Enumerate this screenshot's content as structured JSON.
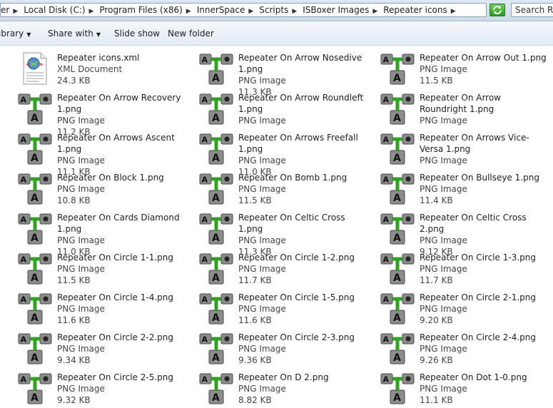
{
  "address": {
    "crumbs": [
      "er",
      "Local Disk (C:)",
      "Program Files (x86)",
      "InnerSpace",
      "Scripts",
      "ISBoxer Images",
      "Repeater icons"
    ],
    "search_placeholder": "Search Rep"
  },
  "toolbar": {
    "library": "ibrary",
    "share": "Share with",
    "slideshow": "Slide show",
    "newfolder": "New folder"
  },
  "files": [
    {
      "name": "Repeater icons.xml",
      "type": "XML Document",
      "size": "24.3 KB",
      "icon": "xml-document-icon"
    },
    {
      "name": "Repeater On Arrow Nosedive 1.png",
      "type": "PNG Image",
      "size": "11.3 KB",
      "icon": "repeater-png-icon"
    },
    {
      "name": "Repeater On Arrow Out 1.png",
      "type": "PNG Image",
      "size": "11.5 KB",
      "icon": "repeater-png-icon"
    },
    {
      "name": "Repeater On Arrow Recovery 1.png",
      "type": "PNG Image",
      "size": "11.2 KB",
      "icon": "repeater-png-icon"
    },
    {
      "name": "Repeater On Arrow Roundleft 1.png",
      "type": "PNG Image",
      "size": "",
      "icon": "repeater-png-icon"
    },
    {
      "name": "Repeater On Arrow Roundright 1.png",
      "type": "PNG Image",
      "size": "",
      "icon": "repeater-png-icon"
    },
    {
      "name": "Repeater On Arrows Ascent 1.png",
      "type": "PNG Image",
      "size": "11.1 KB",
      "icon": "repeater-png-icon"
    },
    {
      "name": "Repeater On Arrows Freefall 1.png",
      "type": "PNG Image",
      "size": "11.0 KB",
      "icon": "repeater-png-icon"
    },
    {
      "name": "Repeater On Arrows Vice-Versa 1.png",
      "type": "PNG Image",
      "size": "",
      "icon": "repeater-png-icon"
    },
    {
      "name": "Repeater On Block 1.png",
      "type": "PNG Image",
      "size": "10.8 KB",
      "icon": "repeater-png-icon"
    },
    {
      "name": "Repeater On Bomb 1.png",
      "type": "PNG Image",
      "size": "11.5 KB",
      "icon": "repeater-png-icon"
    },
    {
      "name": "Repeater On Bullseye 1.png",
      "type": "PNG Image",
      "size": "11.4 KB",
      "icon": "repeater-png-icon"
    },
    {
      "name": "Repeater On Cards Diamond 1.png",
      "type": "PNG Image",
      "size": "11.0 KB",
      "icon": "repeater-png-icon"
    },
    {
      "name": "Repeater On Celtic Cross 1.png",
      "type": "PNG Image",
      "size": "11.3 KB",
      "icon": "repeater-png-icon"
    },
    {
      "name": "Repeater On Celtic Cross 2.png",
      "type": "PNG Image",
      "size": "9.12 KB",
      "icon": "repeater-png-icon"
    },
    {
      "name": "Repeater On Circle 1-1.png",
      "type": "PNG Image",
      "size": "11.5 KB",
      "icon": "repeater-png-icon"
    },
    {
      "name": "Repeater On Circle 1-2.png",
      "type": "PNG Image",
      "size": "11.7 KB",
      "icon": "repeater-png-icon"
    },
    {
      "name": "Repeater On Circle 1-3.png",
      "type": "PNG Image",
      "size": "11.7 KB",
      "icon": "repeater-png-icon"
    },
    {
      "name": "Repeater On Circle 1-4.png",
      "type": "PNG Image",
      "size": "11.6 KB",
      "icon": "repeater-png-icon"
    },
    {
      "name": "Repeater On Circle 1-5.png",
      "type": "PNG Image",
      "size": "11.6 KB",
      "icon": "repeater-png-icon"
    },
    {
      "name": "Repeater On Circle 2-1.png",
      "type": "PNG Image",
      "size": "9.20 KB",
      "icon": "repeater-png-icon"
    },
    {
      "name": "Repeater On Circle 2-2.png",
      "type": "PNG Image",
      "size": "9.34 KB",
      "icon": "repeater-png-icon"
    },
    {
      "name": "Repeater On Circle 2-3.png",
      "type": "PNG Image",
      "size": "9.36 KB",
      "icon": "repeater-png-icon"
    },
    {
      "name": "Repeater On Circle 2-4.png",
      "type": "PNG Image",
      "size": "9.26 KB",
      "icon": "repeater-png-icon"
    },
    {
      "name": "Repeater On Circle 2-5.png",
      "type": "PNG Image",
      "size": "9.32 KB",
      "icon": "repeater-png-icon"
    },
    {
      "name": "Repeater On D 2.png",
      "type": "PNG Image",
      "size": "8.82 KB",
      "icon": "repeater-png-icon"
    },
    {
      "name": "Repeater On Dot 1-0.png",
      "type": "PNG Image",
      "size": "11.1 KB",
      "icon": "repeater-png-icon"
    }
  ],
  "colors": {
    "repeater_green": "#2fa21f",
    "tile_gray": "#8c8c8c",
    "toolbar_bg": "#e8eef6"
  }
}
